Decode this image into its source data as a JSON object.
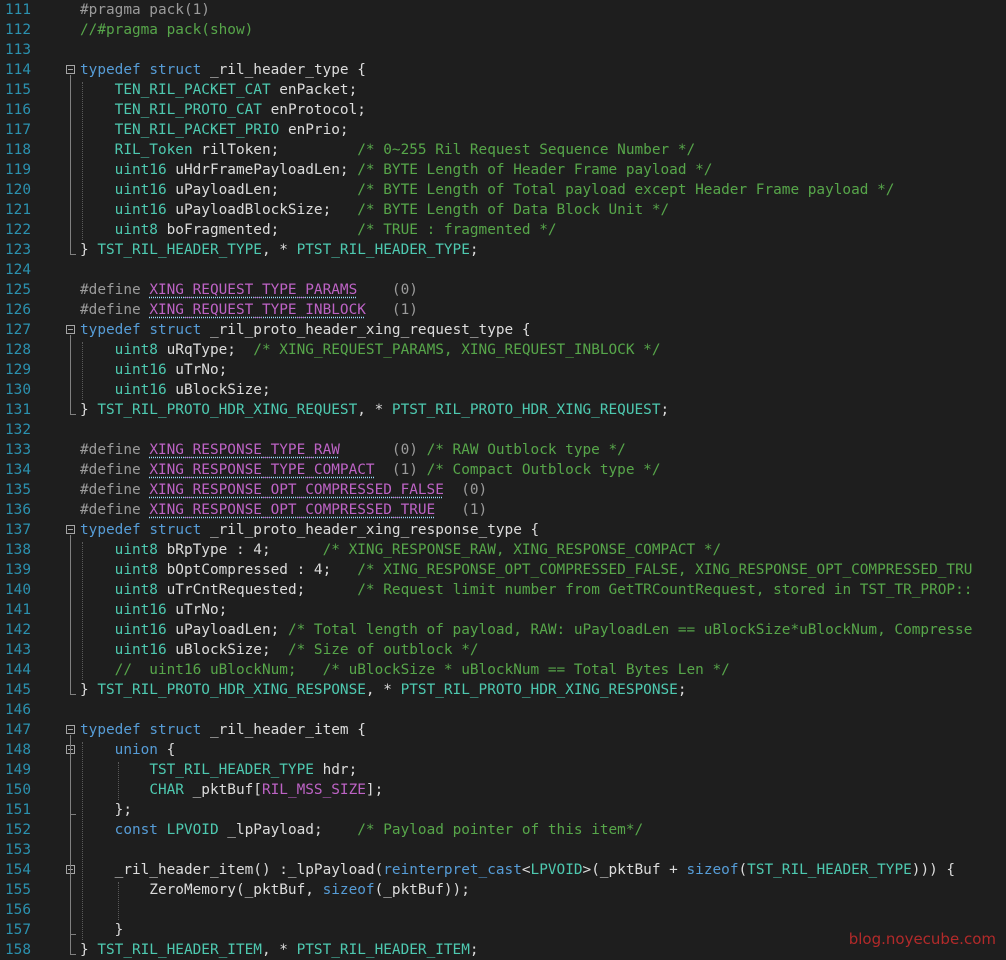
{
  "editor": {
    "language": "cpp",
    "lines": [
      {
        "n": "111",
        "fold": false,
        "tokens": [
          {
            "t": "#pragma pack(1)",
            "c": "pp"
          }
        ]
      },
      {
        "n": "112",
        "fold": false,
        "tokens": [
          {
            "t": "//#pragma pack(show)",
            "c": "cm"
          }
        ]
      },
      {
        "n": "113",
        "fold": false,
        "tokens": []
      },
      {
        "n": "114",
        "fold": true,
        "tokens": [
          {
            "t": "typedef",
            "c": "kw"
          },
          {
            "t": " ",
            "c": "tx"
          },
          {
            "t": "struct",
            "c": "kw"
          },
          {
            "t": " _ril_header_type {",
            "c": "tx"
          }
        ]
      },
      {
        "n": "115",
        "fold": false,
        "tokens": [
          {
            "t": "    ",
            "c": "tx"
          },
          {
            "t": "TEN_RIL_PACKET_CAT",
            "c": "ty"
          },
          {
            "t": " enPacket;",
            "c": "tx"
          }
        ]
      },
      {
        "n": "116",
        "fold": false,
        "tokens": [
          {
            "t": "    ",
            "c": "tx"
          },
          {
            "t": "TEN_RIL_PROTO_CAT",
            "c": "ty"
          },
          {
            "t": " enProtocol;",
            "c": "tx"
          }
        ]
      },
      {
        "n": "117",
        "fold": false,
        "tokens": [
          {
            "t": "    ",
            "c": "tx"
          },
          {
            "t": "TEN_RIL_PACKET_PRIO",
            "c": "ty"
          },
          {
            "t": " enPrio;",
            "c": "tx"
          }
        ]
      },
      {
        "n": "118",
        "fold": false,
        "tokens": [
          {
            "t": "    ",
            "c": "tx"
          },
          {
            "t": "RIL_Token",
            "c": "ty"
          },
          {
            "t": " rilToken;         ",
            "c": "tx"
          },
          {
            "t": "/* 0~255 Ril Request Sequence Number */",
            "c": "cm"
          }
        ]
      },
      {
        "n": "119",
        "fold": false,
        "tokens": [
          {
            "t": "    ",
            "c": "tx"
          },
          {
            "t": "uint16",
            "c": "ty"
          },
          {
            "t": " uHdrFramePayloadLen; ",
            "c": "tx"
          },
          {
            "t": "/* BYTE Length of Header Frame payload */",
            "c": "cm"
          }
        ]
      },
      {
        "n": "120",
        "fold": false,
        "tokens": [
          {
            "t": "    ",
            "c": "tx"
          },
          {
            "t": "uint16",
            "c": "ty"
          },
          {
            "t": " uPayloadLen;         ",
            "c": "tx"
          },
          {
            "t": "/* BYTE Length of Total payload except Header Frame payload */",
            "c": "cm"
          }
        ]
      },
      {
        "n": "121",
        "fold": false,
        "tokens": [
          {
            "t": "    ",
            "c": "tx"
          },
          {
            "t": "uint16",
            "c": "ty"
          },
          {
            "t": " uPayloadBlockSize;   ",
            "c": "tx"
          },
          {
            "t": "/* BYTE Length of Data Block Unit */",
            "c": "cm"
          }
        ]
      },
      {
        "n": "122",
        "fold": false,
        "tokens": [
          {
            "t": "    ",
            "c": "tx"
          },
          {
            "t": "uint8",
            "c": "ty"
          },
          {
            "t": " boFragmented;         ",
            "c": "tx"
          },
          {
            "t": "/* TRUE : fragmented */",
            "c": "cm"
          }
        ]
      },
      {
        "n": "123",
        "fold": false,
        "tokens": [
          {
            "t": "} ",
            "c": "tx"
          },
          {
            "t": "TST_RIL_HEADER_TYPE",
            "c": "ty"
          },
          {
            "t": ", * ",
            "c": "tx"
          },
          {
            "t": "PTST_RIL_HEADER_TYPE",
            "c": "ty"
          },
          {
            "t": ";",
            "c": "tx"
          }
        ]
      },
      {
        "n": "124",
        "fold": false,
        "tokens": []
      },
      {
        "n": "125",
        "fold": false,
        "tokens": [
          {
            "t": "#define ",
            "c": "pp"
          },
          {
            "t": "XING_REQUEST_TYPE_PARAMS",
            "c": "mc"
          },
          {
            "t": "    (0)",
            "c": "pp"
          }
        ]
      },
      {
        "n": "126",
        "fold": false,
        "tokens": [
          {
            "t": "#define ",
            "c": "pp"
          },
          {
            "t": "XING_REQUEST_TYPE_INBLOCK",
            "c": "mc"
          },
          {
            "t": "   (1)",
            "c": "pp"
          }
        ]
      },
      {
        "n": "127",
        "fold": true,
        "tokens": [
          {
            "t": "typedef",
            "c": "kw"
          },
          {
            "t": " ",
            "c": "tx"
          },
          {
            "t": "struct",
            "c": "kw"
          },
          {
            "t": " _ril_proto_header_xing_request_type {",
            "c": "tx"
          }
        ]
      },
      {
        "n": "128",
        "fold": false,
        "tokens": [
          {
            "t": "    ",
            "c": "tx"
          },
          {
            "t": "uint8",
            "c": "ty"
          },
          {
            "t": " uRqType;  ",
            "c": "tx"
          },
          {
            "t": "/* XING_REQUEST_PARAMS, XING_REQUEST_INBLOCK */",
            "c": "cm"
          }
        ]
      },
      {
        "n": "129",
        "fold": false,
        "tokens": [
          {
            "t": "    ",
            "c": "tx"
          },
          {
            "t": "uint16",
            "c": "ty"
          },
          {
            "t": " uTrNo;",
            "c": "tx"
          }
        ]
      },
      {
        "n": "130",
        "fold": false,
        "tokens": [
          {
            "t": "    ",
            "c": "tx"
          },
          {
            "t": "uint16",
            "c": "ty"
          },
          {
            "t": " uBlockSize;",
            "c": "tx"
          }
        ]
      },
      {
        "n": "131",
        "fold": false,
        "tokens": [
          {
            "t": "} ",
            "c": "tx"
          },
          {
            "t": "TST_RIL_PROTO_HDR_XING_REQUEST",
            "c": "ty"
          },
          {
            "t": ", * ",
            "c": "tx"
          },
          {
            "t": "PTST_RIL_PROTO_HDR_XING_REQUEST",
            "c": "ty"
          },
          {
            "t": ";",
            "c": "tx"
          }
        ]
      },
      {
        "n": "132",
        "fold": false,
        "tokens": []
      },
      {
        "n": "133",
        "fold": false,
        "tokens": [
          {
            "t": "#define ",
            "c": "pp"
          },
          {
            "t": "XING_RESPONSE_TYPE_RAW",
            "c": "mc"
          },
          {
            "t": "      (0) ",
            "c": "pp"
          },
          {
            "t": "/* RAW Outblock type */",
            "c": "cm"
          }
        ]
      },
      {
        "n": "134",
        "fold": false,
        "tokens": [
          {
            "t": "#define ",
            "c": "pp"
          },
          {
            "t": "XING_RESPONSE_TYPE_COMPACT",
            "c": "mc"
          },
          {
            "t": "  (1) ",
            "c": "pp"
          },
          {
            "t": "/* Compact Outblock type */",
            "c": "cm"
          }
        ]
      },
      {
        "n": "135",
        "fold": false,
        "tokens": [
          {
            "t": "#define ",
            "c": "pp"
          },
          {
            "t": "XING_RESPONSE_OPT_COMPRESSED_FALSE",
            "c": "mc"
          },
          {
            "t": "  (0)",
            "c": "pp"
          }
        ]
      },
      {
        "n": "136",
        "fold": false,
        "tokens": [
          {
            "t": "#define ",
            "c": "pp"
          },
          {
            "t": "XING_RESPONSE_OPT_COMPRESSED_TRUE",
            "c": "mc"
          },
          {
            "t": "   (1)",
            "c": "pp"
          }
        ]
      },
      {
        "n": "137",
        "fold": true,
        "tokens": [
          {
            "t": "typedef",
            "c": "kw"
          },
          {
            "t": " ",
            "c": "tx"
          },
          {
            "t": "struct",
            "c": "kw"
          },
          {
            "t": " _ril_proto_header_xing_response_type {",
            "c": "tx"
          }
        ]
      },
      {
        "n": "138",
        "fold": false,
        "tokens": [
          {
            "t": "    ",
            "c": "tx"
          },
          {
            "t": "uint8",
            "c": "ty"
          },
          {
            "t": " bRpType : 4;      ",
            "c": "tx"
          },
          {
            "t": "/* XING_RESPONSE_RAW, XING_RESPONSE_COMPACT */",
            "c": "cm"
          }
        ]
      },
      {
        "n": "139",
        "fold": false,
        "tokens": [
          {
            "t": "    ",
            "c": "tx"
          },
          {
            "t": "uint8",
            "c": "ty"
          },
          {
            "t": " bOptCompressed : 4;   ",
            "c": "tx"
          },
          {
            "t": "/* XING_RESPONSE_OPT_COMPRESSED_FALSE, XING_RESPONSE_OPT_COMPRESSED_TRU",
            "c": "cm"
          }
        ]
      },
      {
        "n": "140",
        "fold": false,
        "tokens": [
          {
            "t": "    ",
            "c": "tx"
          },
          {
            "t": "uint8",
            "c": "ty"
          },
          {
            "t": " uTrCntRequested;      ",
            "c": "tx"
          },
          {
            "t": "/* Request limit number from GetTRCountRequest, stored in TST_TR_PROP::",
            "c": "cm"
          }
        ]
      },
      {
        "n": "141",
        "fold": false,
        "tokens": [
          {
            "t": "    ",
            "c": "tx"
          },
          {
            "t": "uint16",
            "c": "ty"
          },
          {
            "t": " uTrNo;",
            "c": "tx"
          }
        ]
      },
      {
        "n": "142",
        "fold": false,
        "tokens": [
          {
            "t": "    ",
            "c": "tx"
          },
          {
            "t": "uint16",
            "c": "ty"
          },
          {
            "t": " uPayloadLen; ",
            "c": "tx"
          },
          {
            "t": "/* Total length of payload, RAW: uPayloadLen == uBlockSize*uBlockNum, Compresse",
            "c": "cm"
          }
        ]
      },
      {
        "n": "143",
        "fold": false,
        "tokens": [
          {
            "t": "    ",
            "c": "tx"
          },
          {
            "t": "uint16",
            "c": "ty"
          },
          {
            "t": " uBlockSize;  ",
            "c": "tx"
          },
          {
            "t": "/* Size of outblock */",
            "c": "cm"
          }
        ]
      },
      {
        "n": "144",
        "fold": false,
        "tokens": [
          {
            "t": "    ",
            "c": "tx"
          },
          {
            "t": "//  uint16 uBlockNum;   /* uBlockSize * uBlockNum == Total Bytes Len */",
            "c": "cm"
          }
        ]
      },
      {
        "n": "145",
        "fold": false,
        "tokens": [
          {
            "t": "} ",
            "c": "tx"
          },
          {
            "t": "TST_RIL_PROTO_HDR_XING_RESPONSE",
            "c": "ty"
          },
          {
            "t": ", * ",
            "c": "tx"
          },
          {
            "t": "PTST_RIL_PROTO_HDR_XING_RESPONSE",
            "c": "ty"
          },
          {
            "t": ";",
            "c": "tx"
          }
        ]
      },
      {
        "n": "146",
        "fold": false,
        "tokens": []
      },
      {
        "n": "147",
        "fold": true,
        "tokens": [
          {
            "t": "typedef",
            "c": "kw"
          },
          {
            "t": " ",
            "c": "tx"
          },
          {
            "t": "struct",
            "c": "kw"
          },
          {
            "t": " _ril_header_item {",
            "c": "tx"
          }
        ]
      },
      {
        "n": "148",
        "fold": true,
        "tokens": [
          {
            "t": "    ",
            "c": "tx"
          },
          {
            "t": "union",
            "c": "kw"
          },
          {
            "t": " {",
            "c": "tx"
          }
        ]
      },
      {
        "n": "149",
        "fold": false,
        "tokens": [
          {
            "t": "        ",
            "c": "tx"
          },
          {
            "t": "TST_RIL_HEADER_TYPE",
            "c": "ty"
          },
          {
            "t": " hdr;",
            "c": "tx"
          }
        ]
      },
      {
        "n": "150",
        "fold": false,
        "tokens": [
          {
            "t": "        ",
            "c": "tx"
          },
          {
            "t": "CHAR",
            "c": "ty"
          },
          {
            "t": " _pktBuf[",
            "c": "tx"
          },
          {
            "t": "RIL_MSS_SIZE",
            "c": "mc"
          },
          {
            "t": "];",
            "c": "tx"
          }
        ]
      },
      {
        "n": "151",
        "fold": false,
        "tokens": [
          {
            "t": "    };",
            "c": "tx"
          }
        ]
      },
      {
        "n": "152",
        "fold": false,
        "tokens": [
          {
            "t": "    ",
            "c": "tx"
          },
          {
            "t": "const",
            "c": "kw"
          },
          {
            "t": " ",
            "c": "tx"
          },
          {
            "t": "LPVOID",
            "c": "ty"
          },
          {
            "t": " _lpPayload;    ",
            "c": "tx"
          },
          {
            "t": "/* Payload pointer of this item*/",
            "c": "cm"
          }
        ]
      },
      {
        "n": "153",
        "fold": false,
        "tokens": []
      },
      {
        "n": "154",
        "fold": true,
        "tokens": [
          {
            "t": "    _ril_header_item() :_lpPayload(",
            "c": "tx"
          },
          {
            "t": "reinterpret_cast",
            "c": "kw"
          },
          {
            "t": "<",
            "c": "tx"
          },
          {
            "t": "LPVOID",
            "c": "ty"
          },
          {
            "t": ">(_pktBuf + ",
            "c": "tx"
          },
          {
            "t": "sizeof",
            "c": "kw"
          },
          {
            "t": "(",
            "c": "tx"
          },
          {
            "t": "TST_RIL_HEADER_TYPE",
            "c": "ty"
          },
          {
            "t": "))) {",
            "c": "tx"
          }
        ]
      },
      {
        "n": "155",
        "fold": false,
        "tokens": [
          {
            "t": "        ZeroMemory(_pktBuf, ",
            "c": "tx"
          },
          {
            "t": "sizeof",
            "c": "kw"
          },
          {
            "t": "(_pktBuf));",
            "c": "tx"
          }
        ]
      },
      {
        "n": "156",
        "fold": false,
        "tokens": []
      },
      {
        "n": "157",
        "fold": false,
        "tokens": [
          {
            "t": "    }",
            "c": "tx"
          }
        ]
      },
      {
        "n": "158",
        "fold": false,
        "tokens": [
          {
            "t": "} ",
            "c": "tx"
          },
          {
            "t": "TST_RIL_HEADER_ITEM",
            "c": "ty"
          },
          {
            "t": ", * ",
            "c": "tx"
          },
          {
            "t": "PTST_RIL_HEADER_ITEM",
            "c": "ty"
          },
          {
            "t": ";",
            "c": "tx"
          }
        ]
      }
    ]
  },
  "watermark": "blog.noyecube.com",
  "colors": {
    "background": "#1e1e1e",
    "line_number": "#2b91af",
    "keyword": "#569cd6",
    "preprocessor": "#9b9b9b",
    "type": "#4ec9b0",
    "comment": "#57a64a",
    "text": "#dcdcdc",
    "macro": "#bd63c5",
    "watermark": "#b22a2a"
  }
}
